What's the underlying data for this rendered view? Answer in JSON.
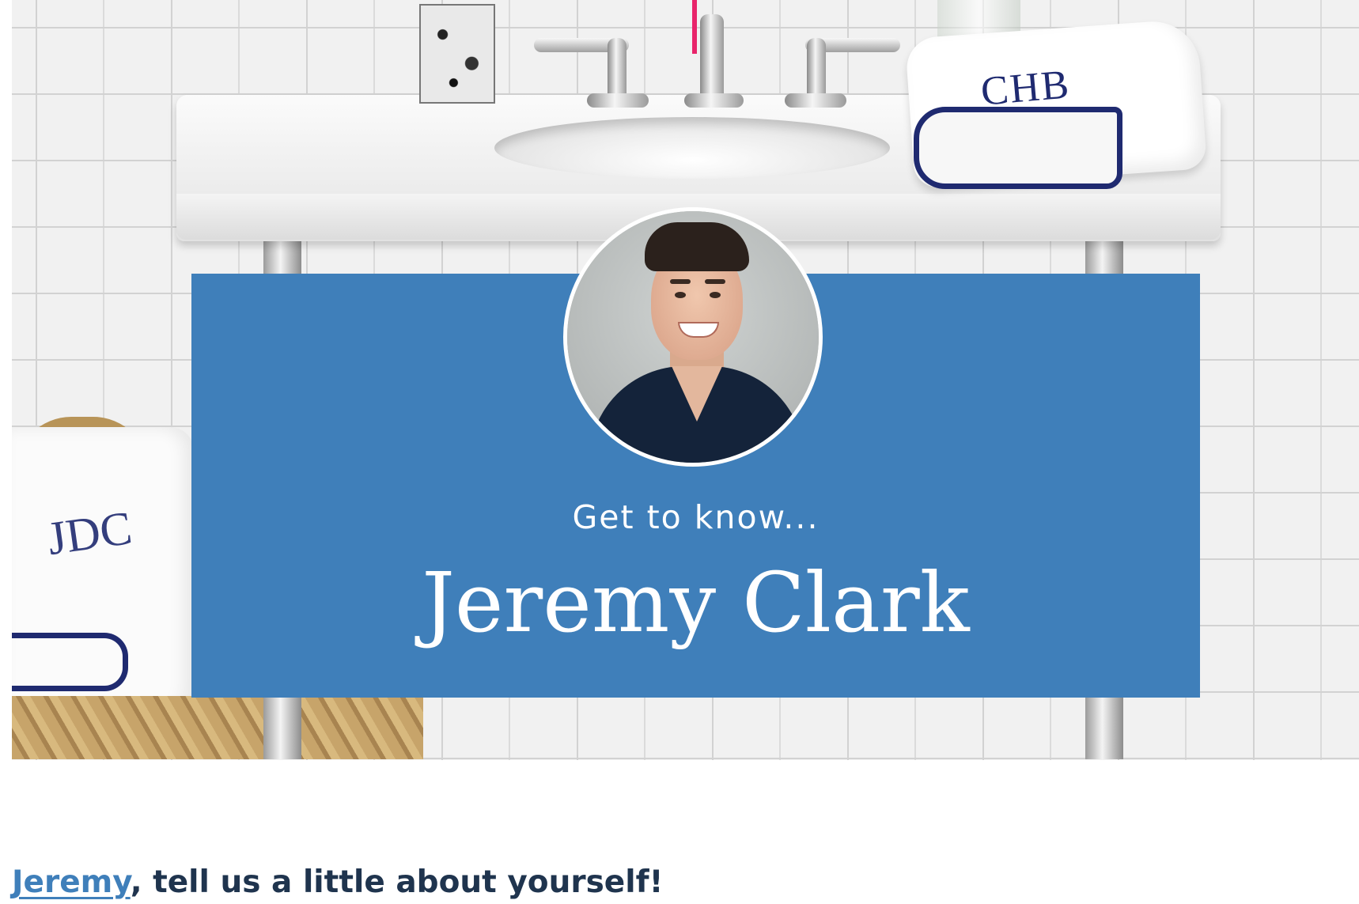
{
  "hero": {
    "image_alt_subject": "bathroom-vanity-photo",
    "banner": {
      "kicker": "Get to know...",
      "name": "Jeremy Clark",
      "color": "#3f7fba"
    },
    "monograms": {
      "right_towel": "CHB",
      "left_towel": "JDC"
    }
  },
  "intro": {
    "link_text": "Jeremy",
    "rest_text": ", tell us a little about yourself!",
    "link_color": "#3f7fba",
    "text_color": "#1f344e"
  }
}
